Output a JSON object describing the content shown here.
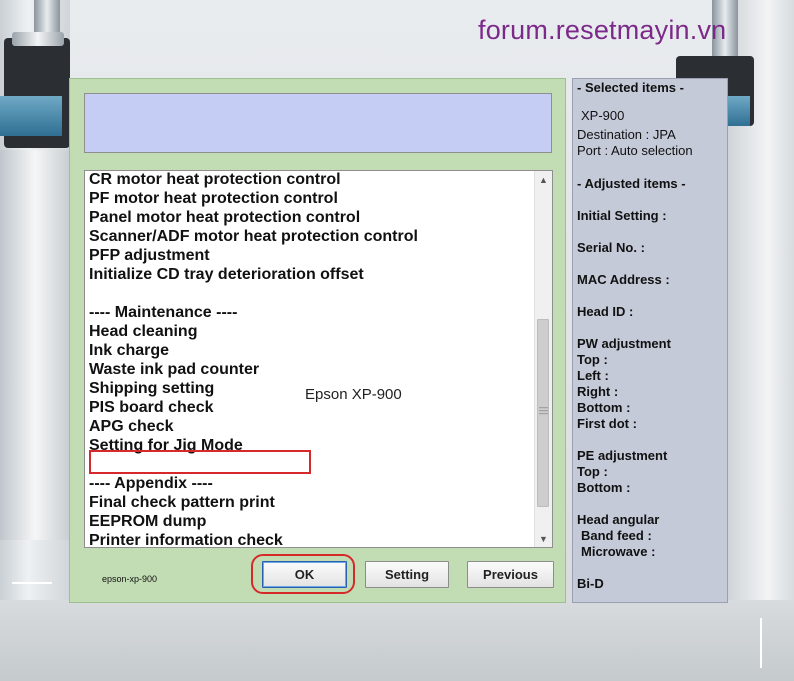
{
  "watermark": "forum.resetmayin.vn",
  "dialog": {
    "list_items": [
      "CR motor heat protection control",
      "PF motor heat protection control",
      "Panel motor heat protection control",
      "Scanner/ADF motor heat protection control",
      "PFP adjustment",
      "Initialize CD tray deterioration offset",
      "",
      "---- Maintenance ----",
      "Head cleaning",
      "Ink charge",
      "Waste ink pad counter",
      "Shipping setting",
      "PIS board check",
      "APG check",
      "Setting for Jig Mode",
      "",
      "---- Appendix ----",
      "Final check pattern print",
      "EEPROM dump",
      "Printer information check"
    ],
    "selected_item": "Waste ink pad counter",
    "center_label": "Epson XP-900",
    "footer_label": "epson-xp-900",
    "buttons": {
      "ok": "OK",
      "setting": "Setting",
      "previous": "Previous"
    }
  },
  "side_panel": {
    "selected_header": "- Selected items -",
    "model": "XP-900",
    "destination": "Destination : JPA",
    "port": "Port : Auto selection",
    "adjusted_header": "- Adjusted items -",
    "initial_setting": "Initial Setting :",
    "serial_no": "Serial No. :",
    "mac_address": "MAC Address :",
    "head_id": "Head ID :",
    "pw_adjustment": "PW adjustment",
    "pw_top": "Top :",
    "pw_left": "Left :",
    "pw_right": "Right :",
    "pw_bottom": "Bottom :",
    "pw_first_dot": "First dot :",
    "pe_adjustment": "PE adjustment",
    "pe_top": "Top :",
    "pe_bottom": "Bottom :",
    "head_angular": "Head angular",
    "band_feed": "Band feed :",
    "microwave": "Microwave :",
    "bid": "Bi-D"
  },
  "colors": {
    "dialog_bg": "#c2dcb3",
    "info_box_bg": "#c5cdf4",
    "side_panel_bg": "#c5cad9",
    "highlight": "#d62a2a",
    "watermark": "#7b2a8a"
  },
  "icons": {
    "scroll_up": "chevron-up-icon",
    "scroll_down": "chevron-down-icon",
    "scroll_grip": "grip-icon"
  }
}
